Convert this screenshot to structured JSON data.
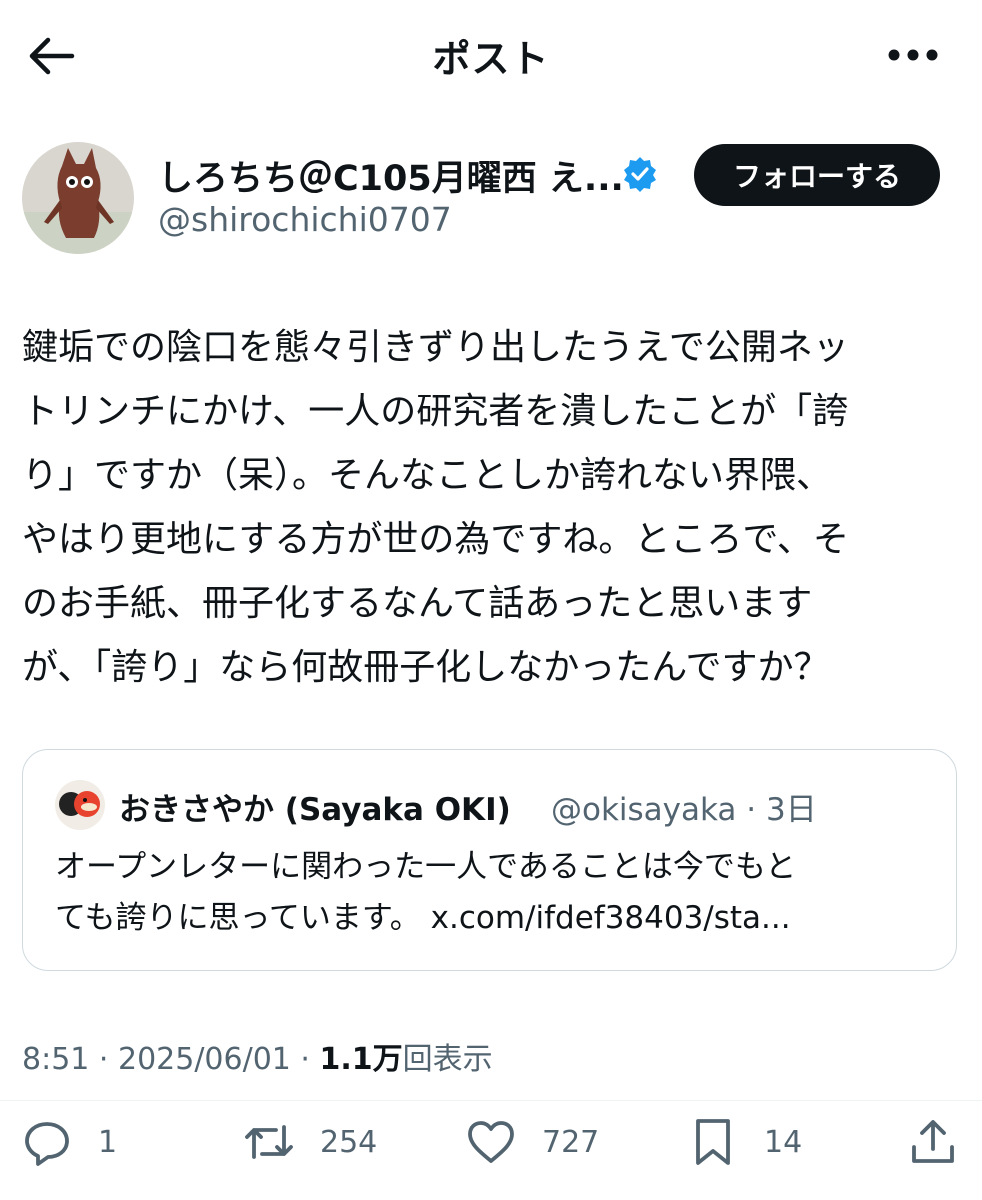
{
  "header": {
    "title": "ポスト"
  },
  "author": {
    "name": "しろちち＠C105月曜西 え...",
    "handle": "@shirochichi0707",
    "follow_label": "フォローする"
  },
  "post": {
    "text": "鍵垢での陰口を態々引きずり出したうえで公開ネッ\nトリンチにかけ、一人の研究者を潰したことが「誇\nり」ですか（呆）。そんなことしか誇れない界隈、\nやはり更地にする方が世の為ですね。ところで、そ\nのお手紙、冊子化するなんて話あったと思います\nが、「誇り」なら何故冊子化しなかったんですか？"
  },
  "quote": {
    "name": "おきさやか (Sayaka OKI)",
    "handle": "@okisayaka · 3日",
    "text": "オープンレターに関わった一人であることは今でもと\nても誇りに思っています。 x.com/ifdef38403/sta..."
  },
  "meta": {
    "time": "8:51 · 2025/06/01 · ",
    "views_count": "1.1万",
    "views_label": "回表示"
  },
  "actions": {
    "reply_count": "1",
    "retweet_count": "254",
    "like_count": "727",
    "bookmark_count": "14"
  },
  "colors": {
    "text": "#0f1419",
    "secondary": "#536471",
    "verified": "#1d9bf0",
    "border": "#cfd9de"
  }
}
